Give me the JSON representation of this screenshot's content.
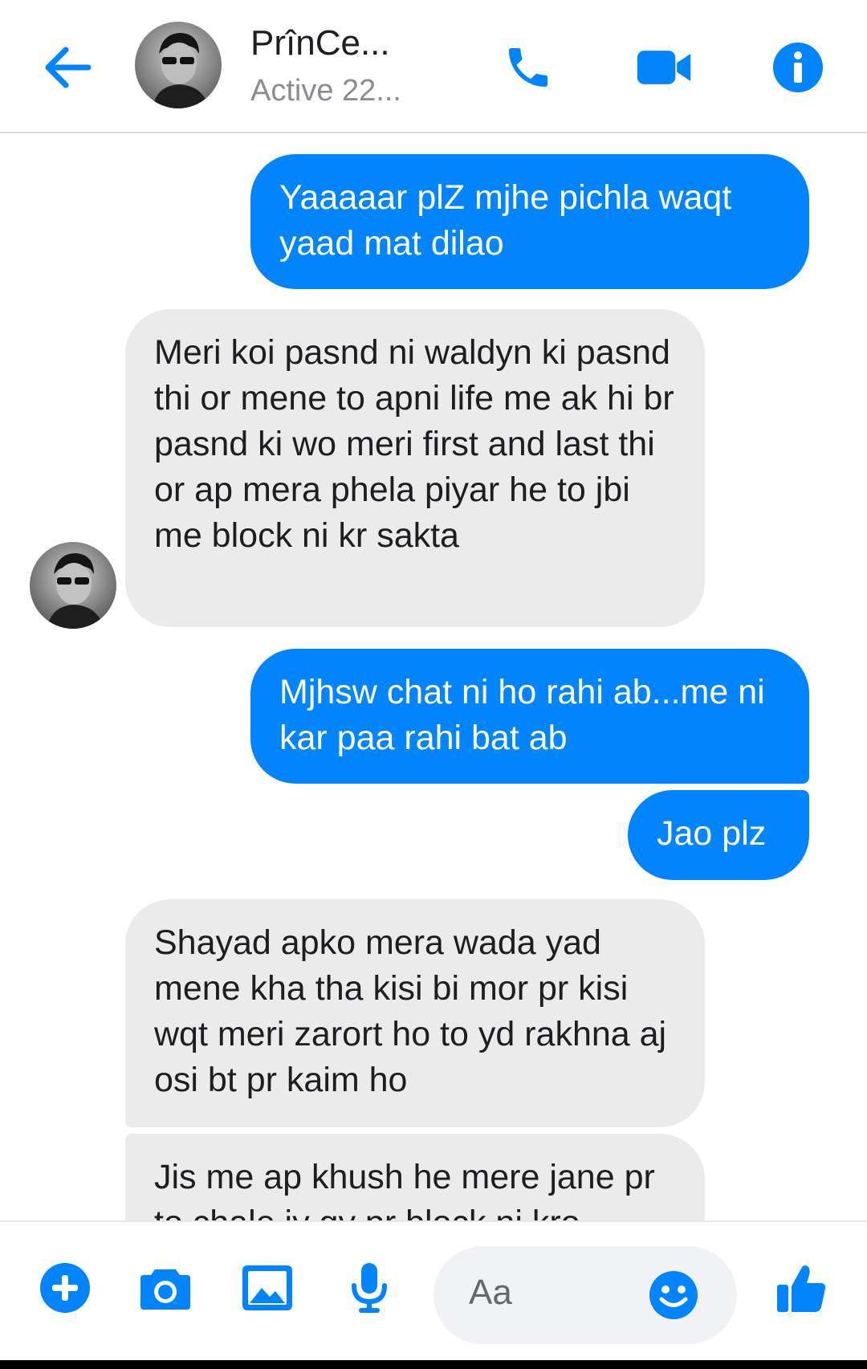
{
  "header": {
    "name": "PrînCe...",
    "status": "Active 22...",
    "accent": "#0084ff"
  },
  "messages": [
    {
      "direction": "sent",
      "text": "Yaaaaar plZ mjhe pichla waqt yaad mat dilao"
    },
    {
      "direction": "received",
      "text": "Meri koi pasnd ni waldyn ki pasnd thi or mene to apni life me ak hi br pasnd ki wo meri first and  last thi or ap mera phela piyar he to jbi me block ni kr sakta"
    },
    {
      "direction": "sent",
      "text": "Mjhsw chat ni ho rahi ab...me ni kar paa rahi bat ab"
    },
    {
      "direction": "sent",
      "text": "Jao plz"
    },
    {
      "direction": "received",
      "text": "Shayad apko mera wada yad mene kha tha kisi bi mor pr kisi wqt meri zarort ho to yd rakhna aj osi bt pr kaim ho"
    },
    {
      "direction": "received",
      "text": "Jis me ap khush he mere jane pr to chale jy gy pr block ni kro"
    }
  ],
  "composer": {
    "placeholder": "Aa"
  },
  "icons": [
    "back-arrow-icon",
    "phone-icon",
    "video-camera-icon",
    "info-icon",
    "plus-icon",
    "camera-icon",
    "image-icon",
    "microphone-icon",
    "smiley-icon",
    "thumbs-up-icon"
  ]
}
